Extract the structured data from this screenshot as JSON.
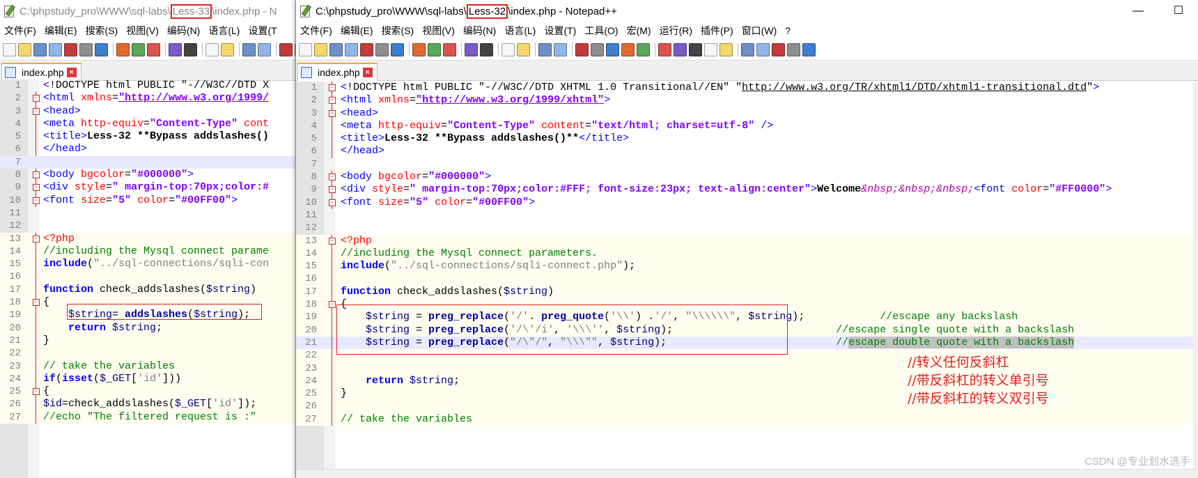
{
  "left_window": {
    "title_prefix": "C:\\phpstudy_pro\\WWW\\sql-labs\\",
    "title_highlight": "Less-33",
    "title_suffix": "\\index.php - N",
    "menu": [
      "文件(F)",
      "编辑(E)",
      "搜索(S)",
      "视图(V)",
      "编码(N)",
      "语言(L)",
      "设置(T"
    ],
    "tab_label": "index.php",
    "lines": [
      {
        "n": "1",
        "html": "<span class='tg'>&lt;</span>!DOCTYPE html PUBLIC \"-//W3C//DTD X"
      },
      {
        "n": "2",
        "html": "<span class='tg'>&lt;html</span> <span class='at'>xmlns</span>=<span class='ur'>\"http://www.w3.org/1999/</span>"
      },
      {
        "n": "3",
        "html": "<span class='tg'>&lt;head&gt;</span>"
      },
      {
        "n": "4",
        "html": "<span class='tg'>&lt;meta</span> <span class='at'>http-equiv</span>=<span class='av'>\"Content-Type\"</span> <span class='at'>cont</span>"
      },
      {
        "n": "5",
        "html": "<span class='tg'>&lt;title&gt;</span><span class='bd'>Less-32 **Bypass addslashes()</span>"
      },
      {
        "n": "6",
        "html": "<span class='tg'>&lt;/head&gt;</span>"
      },
      {
        "n": "7",
        "html": "",
        "cur": true
      },
      {
        "n": "8",
        "html": "<span class='tg'>&lt;body</span> <span class='at'>bgcolor</span>=<span class='av'>\"#000000\"</span><span class='tg'>&gt;</span>"
      },
      {
        "n": "9",
        "html": "<span class='tg'>&lt;div</span> <span class='at'>style</span>=<span class='av'>\" margin-top:70px;color:#</span>"
      },
      {
        "n": "10",
        "html": "<span class='tg'>&lt;font</span> <span class='at'>size</span>=<span class='av'>\"5\"</span> <span class='at'>color</span>=<span class='av'>\"#00FF00\"</span><span class='tg'>&gt;</span>"
      },
      {
        "n": "11",
        "html": ""
      },
      {
        "n": "12",
        "html": ""
      },
      {
        "n": "13",
        "html": "<span class='ph'>&lt;?php</span>",
        "php": true
      },
      {
        "n": "14",
        "html": "<span class='cm'>//including the Mysql connect parame</span>",
        "php": true
      },
      {
        "n": "15",
        "html": "<span class='kw'>include</span>(<span class='st'>\"../sql-connections/sqli-con</span>",
        "php": true
      },
      {
        "n": "16",
        "html": "",
        "php": true
      },
      {
        "n": "17",
        "html": "<span class='kw'>function</span> check_addslashes(<span class='va'>$string</span>)",
        "php": true
      },
      {
        "n": "18",
        "html": "{",
        "php": true
      },
      {
        "n": "19",
        "html": "    <span class='va'>$string</span>= <span class='fn'>addslashes</span>(<span class='va'>$string</span>);",
        "php": true
      },
      {
        "n": "20",
        "html": "    <span class='kw'>return</span> <span class='va'>$string</span>;",
        "php": true
      },
      {
        "n": "21",
        "html": "}",
        "php": true
      },
      {
        "n": "22",
        "html": "",
        "php": true
      },
      {
        "n": "23",
        "html": "<span class='cm'>// take the variables</span>",
        "php": true
      },
      {
        "n": "24",
        "html": "<span class='kw'>if</span>(<span class='kw'>isset</span>(<span class='va'>$_GET</span>[<span class='st'>'id'</span>]))",
        "php": true
      },
      {
        "n": "25",
        "html": "{",
        "php": true
      },
      {
        "n": "26",
        "html": "<span class='va'>$id</span>=check_addslashes(<span class='va'>$_GET</span>[<span class='st'>'id'</span>]);",
        "php": true
      },
      {
        "n": "27",
        "html": "<span class='cm'>//echo \"The filtered request is :\"</span>",
        "php": true
      }
    ]
  },
  "right_window": {
    "title_prefix": "C:\\phpstudy_pro\\WWW\\sql-labs\\",
    "title_highlight": "Less-32",
    "title_suffix": "\\index.php - Notepad++",
    "minimize": "—",
    "maximize": "☐",
    "menu": [
      "文件(F)",
      "编辑(E)",
      "搜索(S)",
      "视图(V)",
      "编码(N)",
      "语言(L)",
      "设置(T)",
      "工具(O)",
      "宏(M)",
      "运行(R)",
      "插件(P)",
      "窗口(W)",
      "?"
    ],
    "tab_label": "index.php",
    "lines": [
      {
        "n": "1",
        "html": "<span class='tg'>&lt;</span>!DOCTYPE html PUBLIC \"-//W3C//DTD XHTML 1.0 Transitional//EN\" \"<span style='text-decoration:underline'>http://www.w3.org/TR/xhtml1/DTD/xhtml1-transitional.dtd</span>\"<span class='tg'>&gt;</span>"
      },
      {
        "n": "2",
        "html": "<span class='tg'>&lt;html</span> <span class='at'>xmlns</span>=<span class='ur'>\"http://www.w3.org/1999/xhtml\"</span><span class='tg'>&gt;</span>"
      },
      {
        "n": "3",
        "html": "<span class='tg'>&lt;head&gt;</span>"
      },
      {
        "n": "4",
        "html": "<span class='tg'>&lt;meta</span> <span class='at'>http-equiv</span>=<span class='av'>\"Content-Type\"</span> <span class='at'>content</span>=<span class='av'>\"text/html; charset=utf-8\"</span> <span class='tg'>/&gt;</span>"
      },
      {
        "n": "5",
        "html": "<span class='tg'>&lt;title&gt;</span><span class='bd'>Less-32 **Bypass addslashes()**</span><span class='tg'>&lt;/title&gt;</span>"
      },
      {
        "n": "6",
        "html": "<span class='tg'>&lt;/head&gt;</span>"
      },
      {
        "n": "7",
        "html": ""
      },
      {
        "n": "8",
        "html": "<span class='tg'>&lt;body</span> <span class='at'>bgcolor</span>=<span class='av'>\"#000000\"</span><span class='tg'>&gt;</span>"
      },
      {
        "n": "9",
        "html": "<span class='tg'>&lt;div</span> <span class='at'>style</span>=<span class='av'>\" margin-top:70px;color:#FFF; font-size:23px; text-align:center\"</span><span class='tg'>&gt;</span><span class='bd'>Welcome</span><span class='en'>&amp;nbsp;&amp;nbsp;&amp;nbsp;</span><span class='tg'>&lt;font</span> <span class='at'>color</span>=<span class='av'>\"#FF0000\"</span><span class='tg'>&gt;</span>"
      },
      {
        "n": "10",
        "html": "<span class='tg'>&lt;font</span> <span class='at'>size</span>=<span class='av'>\"5\"</span> <span class='at'>color</span>=<span class='av'>\"#00FF00\"</span><span class='tg'>&gt;</span>"
      },
      {
        "n": "11",
        "html": ""
      },
      {
        "n": "12",
        "html": ""
      },
      {
        "n": "13",
        "html": "<span class='ph'>&lt;?php</span>",
        "php": true
      },
      {
        "n": "14",
        "html": "<span class='cm'>//including the Mysql connect parameters.</span>",
        "php": true
      },
      {
        "n": "15",
        "html": "<span class='kw'>include</span>(<span class='st'>\"../sql-connections/sqli-connect.php\"</span>);",
        "php": true
      },
      {
        "n": "16",
        "html": "",
        "php": true
      },
      {
        "n": "17",
        "html": "<span class='kw'>function</span> check_addslashes(<span class='va'>$string</span>)",
        "php": true
      },
      {
        "n": "18",
        "html": "{",
        "php": true
      },
      {
        "n": "19",
        "html": "    <span class='va'>$string</span> = <span class='fn'>preg_replace</span>(<span class='st'>'/'</span>. <span class='fn'>preg_quote</span>(<span class='st'>'\\\\'</span>) .<span class='st'>'/'</span>, <span class='st'>\"\\\\\\\\\\\\\"</span>, <span class='va'>$string</span>);            <span class='cm'>//escape any backslash</span>",
        "php": true
      },
      {
        "n": "20",
        "html": "    <span class='va'>$string</span> = <span class='fn'>preg_replace</span>(<span class='st'>'/\\'/i'</span>, <span class='st'>'\\\\\\''</span>, <span class='va'>$string</span>);                          <span class='cm'>//escape single quote with a backslash</span>",
        "php": true
      },
      {
        "n": "21",
        "html": "    <span class='va'>$string</span> = <span class='fn'>preg_replace</span>(<span class='st'>\"/\\\"/\"</span>, <span class='st'>\"\\\\\\\"\"</span>, <span class='va'>$string</span>);                           <span class='cm'>//<span class='sel'>escape double quote with a backslash</span></span>",
        "php": true,
        "cur": true
      },
      {
        "n": "22",
        "html": "",
        "php": true
      },
      {
        "n": "23",
        "html": "",
        "php": true
      },
      {
        "n": "24",
        "html": "    <span class='kw'>return</span> <span class='va'>$string</span>;",
        "php": true
      },
      {
        "n": "25",
        "html": "}",
        "php": true
      },
      {
        "n": "26",
        "html": "",
        "php": true
      },
      {
        "n": "27",
        "html": "<span class='cm'>// take the variables</span>",
        "php": true
      }
    ]
  },
  "annotations": [
    "//转义任何反斜杠",
    "//带反斜杠的转义单引号",
    "//带反斜杠的转义双引号"
  ],
  "watermark": "CSDN @专业划水选手",
  "colors": {
    "highlight_box": "#e0211e",
    "tab_accent": "#f2a73b"
  }
}
